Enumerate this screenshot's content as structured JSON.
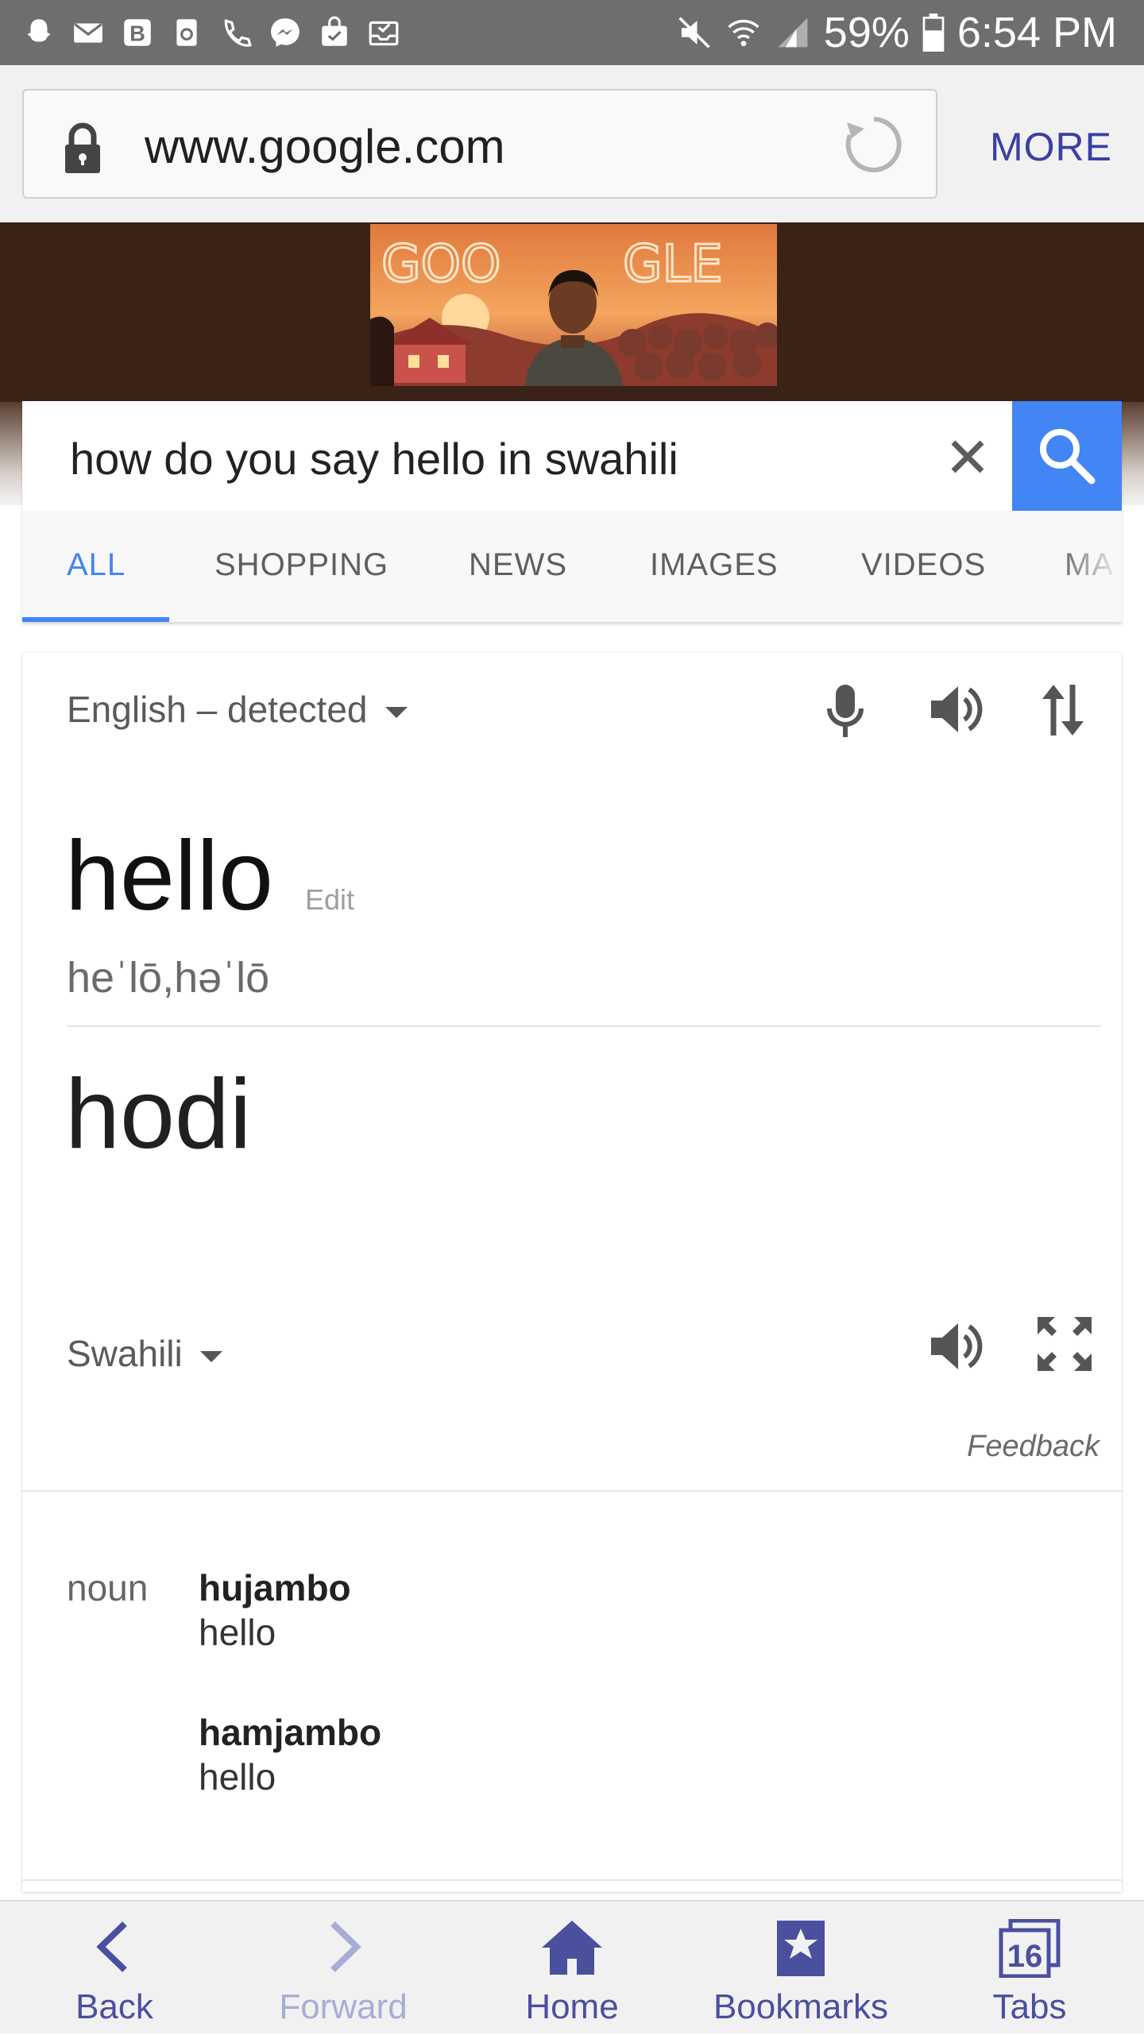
{
  "status_bar": {
    "battery": "59%",
    "time": "6:54 PM",
    "notification_icons": [
      "snapchat-icon",
      "mail-icon",
      "blogger-icon",
      "recycle-icon",
      "phone-missed-icon",
      "messenger-icon",
      "bag-icon",
      "inbox-icon"
    ]
  },
  "browser": {
    "url": "www.google.com",
    "more_label": "MORE"
  },
  "search": {
    "query": "how do you say hello in swahili",
    "tabs": [
      {
        "label": "ALL",
        "active": true
      },
      {
        "label": "SHOPPING"
      },
      {
        "label": "NEWS"
      },
      {
        "label": "IMAGES"
      },
      {
        "label": "VIDEOS"
      },
      {
        "label": "MA"
      }
    ]
  },
  "doodle": {
    "text": "GOOGLE"
  },
  "translate": {
    "source_language": "English – detected",
    "source_word": "hello",
    "edit_label": "Edit",
    "phonetic": "heˈlō,həˈlō",
    "target_word": "hodi",
    "target_language": "Swahili",
    "feedback_label": "Feedback",
    "part_of_speech": "noun",
    "definitions": [
      {
        "word": "hujambo",
        "gloss": "hello"
      },
      {
        "word": "hamjambo",
        "gloss": "hello"
      }
    ]
  },
  "bottom_nav": {
    "items": [
      {
        "label": "Back",
        "enabled": true
      },
      {
        "label": "Forward",
        "enabled": false
      },
      {
        "label": "Home",
        "enabled": true
      },
      {
        "label": "Bookmarks",
        "enabled": true
      },
      {
        "label": "Tabs",
        "enabled": true
      }
    ],
    "tab_count": "16"
  },
  "colors": {
    "accent_blue": "#4285f4",
    "nav_purple": "#4a4f9e"
  }
}
